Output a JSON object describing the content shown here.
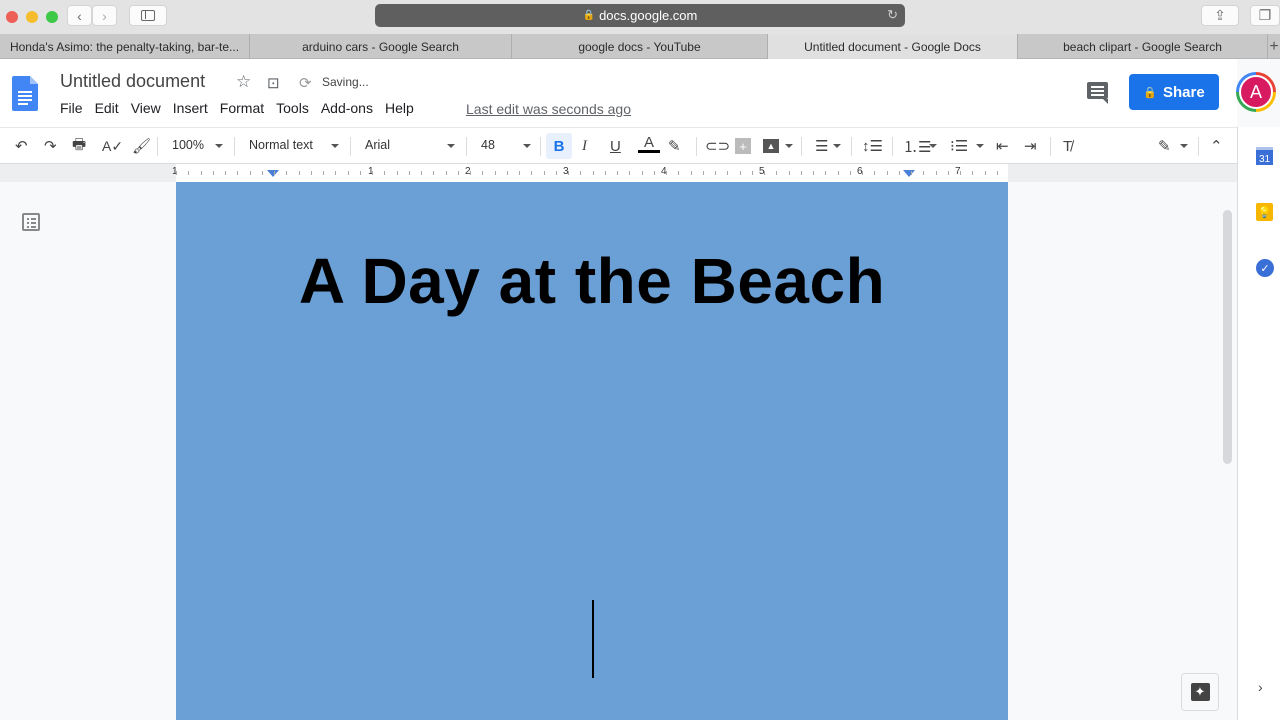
{
  "browser": {
    "url": "docs.google.com",
    "tabs": [
      {
        "label": "Honda's Asimo: the penalty-taking, bar-te...",
        "active": false
      },
      {
        "label": "arduino cars - Google Search",
        "active": false
      },
      {
        "label": "google docs - YouTube",
        "active": false
      },
      {
        "label": "Untitled document - Google Docs",
        "active": true
      },
      {
        "label": "beach clipart - Google Search",
        "active": false
      }
    ],
    "new_tab": "+",
    "traffic_colors": {
      "close": "#ee5f57",
      "minimize": "#f5bd2e",
      "zoom": "#3ec847"
    }
  },
  "docs": {
    "title": "Untitled document",
    "status": "Saving...",
    "menu": [
      "File",
      "Edit",
      "View",
      "Insert",
      "Format",
      "Tools",
      "Add-ons",
      "Help"
    ],
    "last_edit": "Last edit was seconds ago",
    "share_label": "Share",
    "avatar_initial": "A",
    "accent": "#1a73e8"
  },
  "toolbar": {
    "zoom": "100%",
    "style": "Normal text",
    "font": "Arial",
    "size": "48",
    "bold_active": true
  },
  "ruler": {
    "labels": [
      "1",
      "1",
      "2",
      "3",
      "4",
      "5",
      "6",
      "7"
    ]
  },
  "document": {
    "heading": "A Day at the Beach",
    "page_color": "#6aa0d6"
  },
  "side_panel": {
    "calendar_day": "31"
  }
}
